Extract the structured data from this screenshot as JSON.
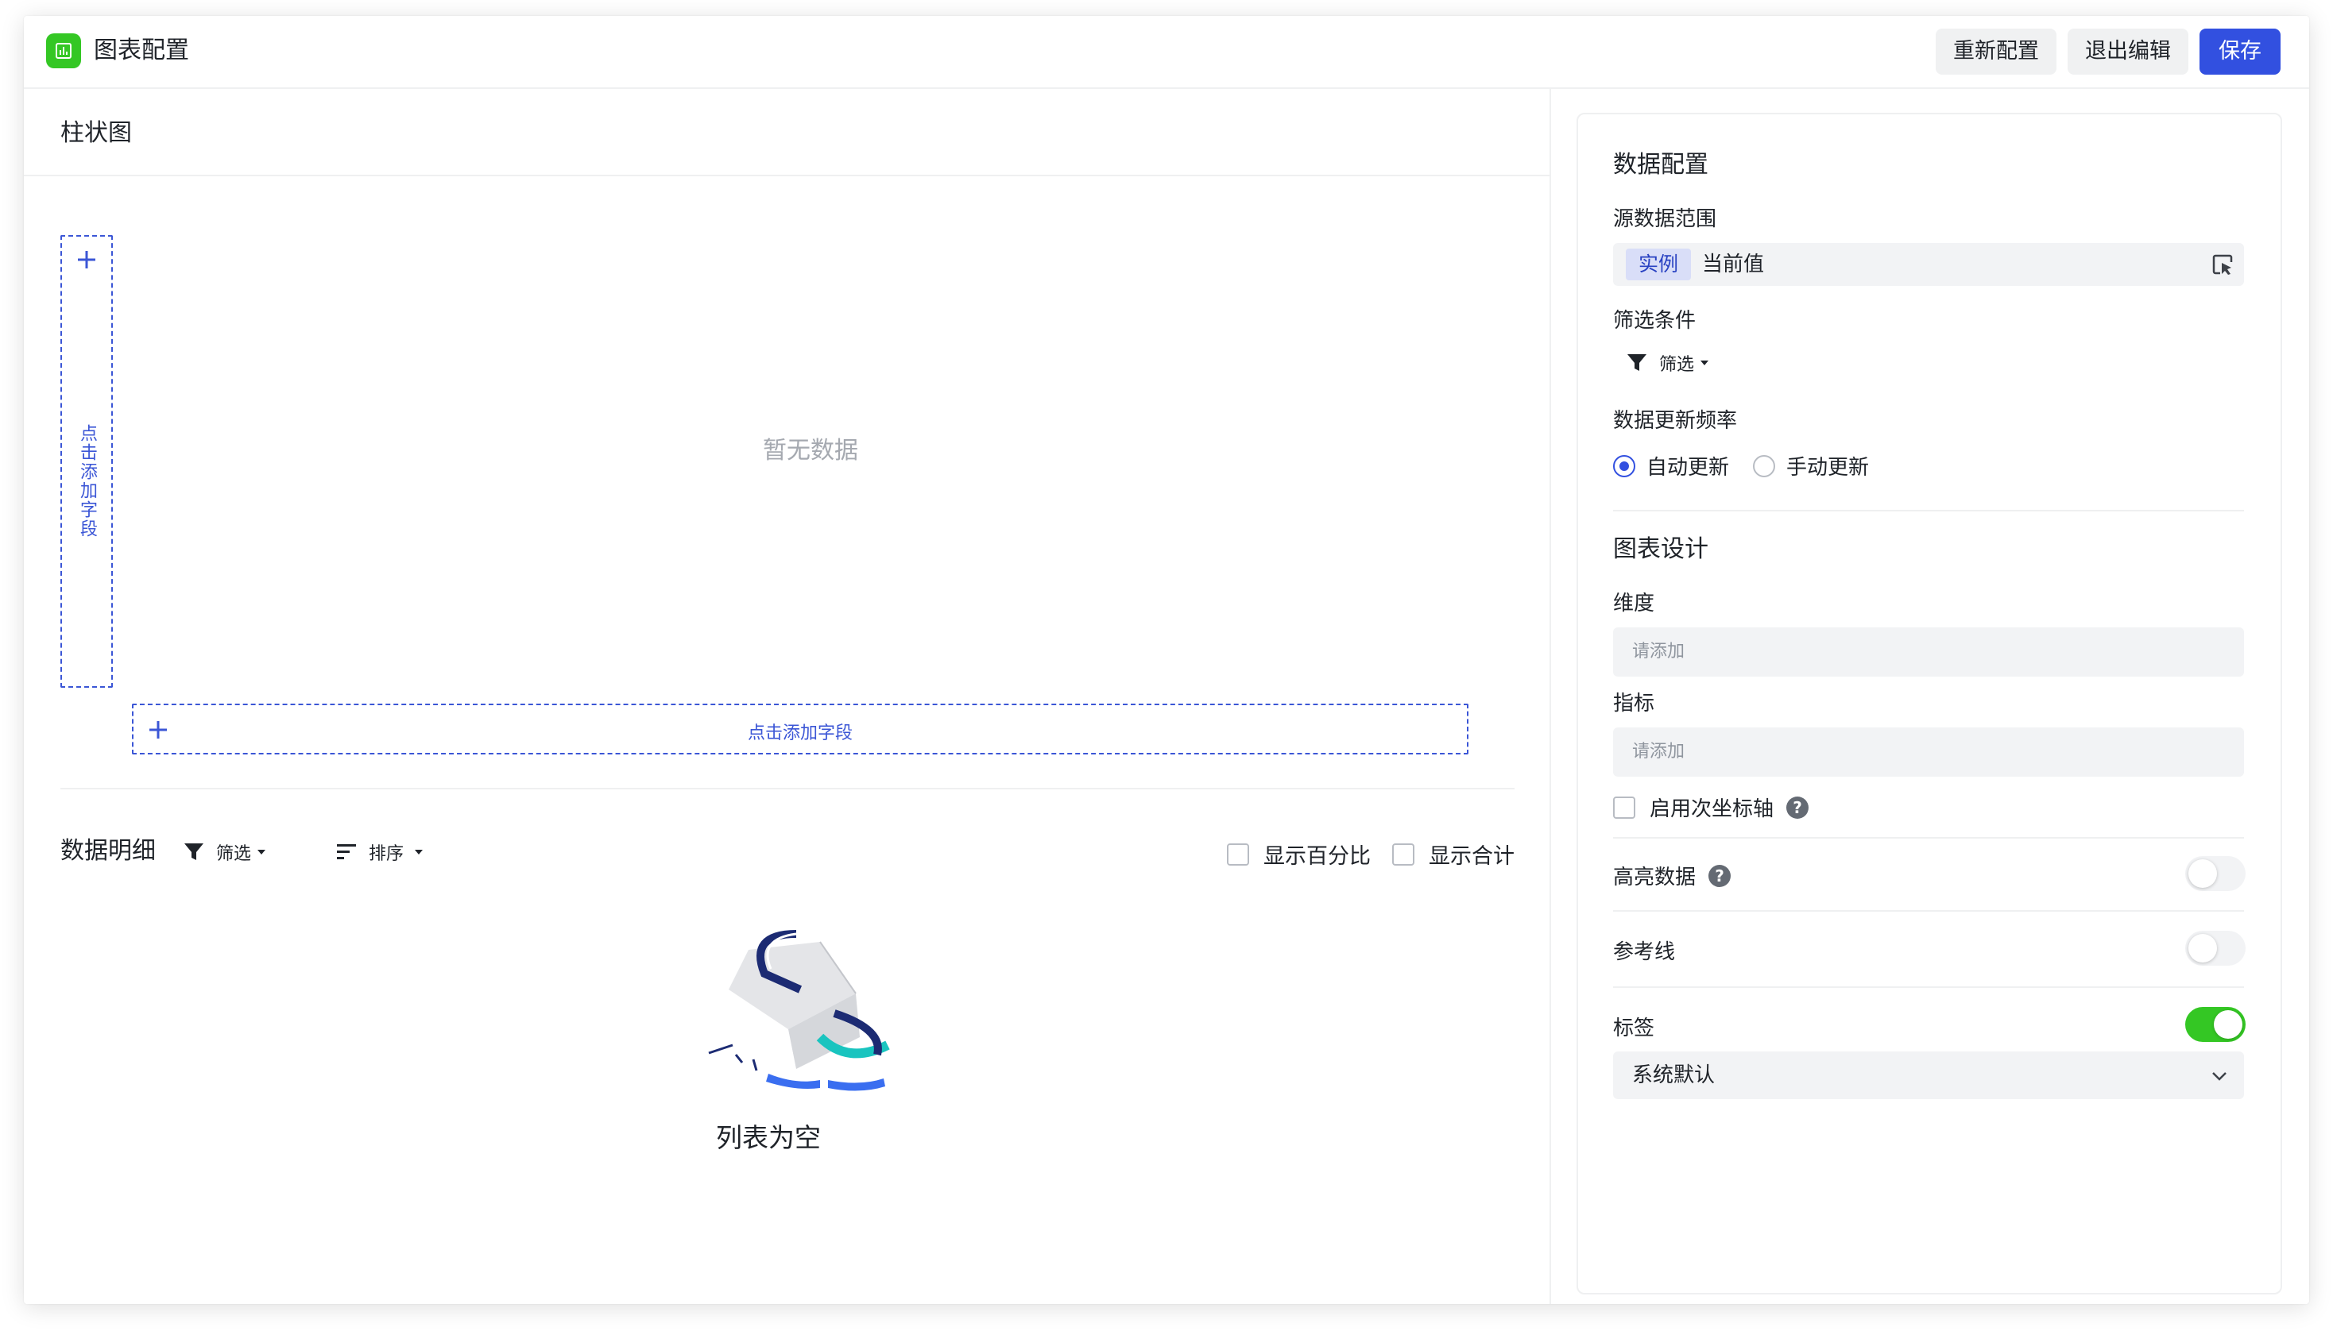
{
  "header": {
    "title": "图表配置",
    "reconfigure_label": "重新配置",
    "exit_edit_label": "退出编辑",
    "save_label": "保存",
    "logo_icon": "bar-chart-icon",
    "accent_color": "#3250e0",
    "logo_color": "#34c724"
  },
  "chart_area": {
    "chart_type": "柱状图",
    "no_data_text": "暂无数据",
    "y_axis_drop_text": "点击添加字段",
    "x_axis_drop_text": "点击添加字段"
  },
  "detail": {
    "title": "数据明细",
    "filter_label": "筛选",
    "sort_label": "排序",
    "show_percent_label": "显示百分比",
    "show_percent_checked": false,
    "show_total_label": "显示合计",
    "show_total_checked": false,
    "empty_text": "列表为空"
  },
  "config": {
    "data_section_title": "数据配置",
    "source_label": "源数据范围",
    "source_tag": "实例",
    "source_value": "当前值",
    "filter_cond_label": "筛选条件",
    "filter_button_label": "筛选",
    "refresh_label": "数据更新频率",
    "refresh_options": [
      "自动更新",
      "手动更新"
    ],
    "refresh_selected": "自动更新",
    "design_section_title": "图表设计",
    "dimension_label": "维度",
    "dimension_placeholder": "请添加",
    "metric_label": "指标",
    "metric_placeholder": "请添加",
    "secondary_axis_label": "启用次坐标轴",
    "secondary_axis_checked": false,
    "highlight_label": "高亮数据",
    "highlight_on": false,
    "reference_line_label": "参考线",
    "reference_line_on": false,
    "label_label": "标签",
    "label_on": true,
    "label_select_value": "系统默认"
  }
}
